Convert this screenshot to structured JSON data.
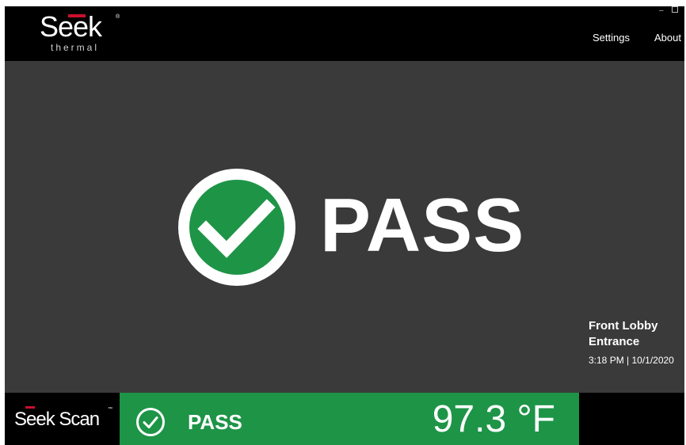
{
  "header": {
    "logo_word": "Seek",
    "logo_sub": "thermal",
    "logo_reg": "®",
    "nav": {
      "settings_label": "Settings",
      "about_label": "About"
    },
    "window_controls": {
      "minimize_glyph": "–"
    }
  },
  "main": {
    "result_label": "PASS",
    "result_icon": "check-circle-icon",
    "location": "Front Lobby Entrance",
    "timestamp": "3:18 PM | 10/1/2020"
  },
  "footer": {
    "brand": "Seek Scan",
    "brand_tm": "™",
    "status_label": "PASS",
    "status_icon": "check-circle-outline-icon",
    "temperature": "97.3 °F"
  },
  "colors": {
    "header_bg": "#000000",
    "main_bg": "#3a3a3a",
    "pass_green": "#1e9447",
    "brand_red": "#c8102e",
    "text": "#ffffff"
  }
}
